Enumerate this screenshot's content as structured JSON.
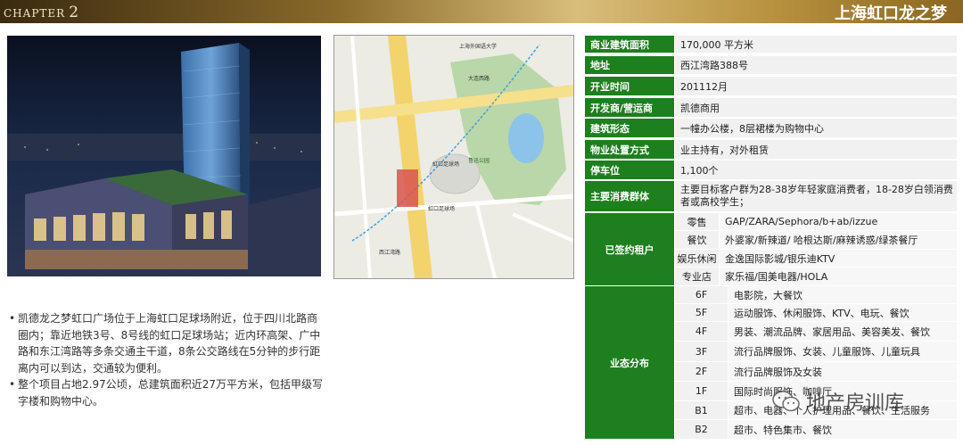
{
  "header": {
    "chapter_label": "CHAPTER",
    "chapter_num": "2",
    "title": "上海虹口龙之梦"
  },
  "map": {
    "labels": {
      "university": "上海外国语大学",
      "park": "鲁迅公园",
      "station1": "虹口足球场",
      "station2": "虹口足球场",
      "road1": "大连西路",
      "road2": "西江湾路"
    }
  },
  "description": [
    "凯德龙之梦虹口广场位于上海虹口足球场附近，位于四川北路商圈内；靠近地铁3号、8号线的虹口足球场站；近内环高架、广中路和东江湾路等多条交通主干道，8条公交路线在5分钟的步行距离内可以到达，交通较为便利。",
    "整个项目占地2.97公顷，总建筑面积近27万平方米，包括甲级写字楼和购物中心。"
  ],
  "info": [
    {
      "label": "商业建筑面积",
      "value": "170,000 平方米"
    },
    {
      "label": "地址",
      "value": "西江湾路388号"
    },
    {
      "label": "开业时间",
      "value": "201112月"
    },
    {
      "label": "开发商/营运商",
      "value": "凯德商用"
    },
    {
      "label": "建筑形态",
      "value": "一幢办公楼，8层裙楼为购物中心"
    },
    {
      "label": "物业处置方式",
      "value": "业主持有，对外租赁"
    },
    {
      "label": "停车位",
      "value": "1,100个"
    },
    {
      "label": "主要消费群体",
      "value": "主要目标客户群为28-38岁年轻家庭消费者，18-28岁白领消费者或高校学生；"
    }
  ],
  "tenants": {
    "label": "已签约租户",
    "rows": [
      {
        "cat": "零售",
        "value": "GAP/ZARA/Sephora/b+ab/izzue"
      },
      {
        "cat": "餐饮",
        "value": "外婆家/新辣道/ 哈根达斯/麻辣诱惑/绿茶餐厅"
      },
      {
        "cat": "娱乐休闲",
        "value": "金逸国际影城/银乐迪KTV"
      },
      {
        "cat": "专业店",
        "value": "家乐福/国美电器/HOLA"
      }
    ]
  },
  "floors": {
    "label": "业态分布",
    "rows": [
      {
        "floor": "6F",
        "value": "电影院，大餐饮"
      },
      {
        "floor": "5F",
        "value": "运动服饰、休闲服饰、KTV、电玩、餐饮"
      },
      {
        "floor": "4F",
        "value": "男装、潮流品牌、家居用品、美容美发、餐饮"
      },
      {
        "floor": "3F",
        "value": "流行品牌服饰、女装、儿童服饰、儿童玩具"
      },
      {
        "floor": "2F",
        "value": "流行品牌服饰及女装"
      },
      {
        "floor": "1F",
        "value": "国际时尚服饰、咖啡厅"
      },
      {
        "floor": "B1",
        "value": "超市、电器、个人护理用品、餐饮、生活服务"
      },
      {
        "floor": "B2",
        "value": "超市、特色集市、餐饮"
      }
    ]
  },
  "watermark": "地产房训库",
  "colors": {
    "label_green": "#1d7f1d",
    "header_gold": "#b8923e"
  }
}
